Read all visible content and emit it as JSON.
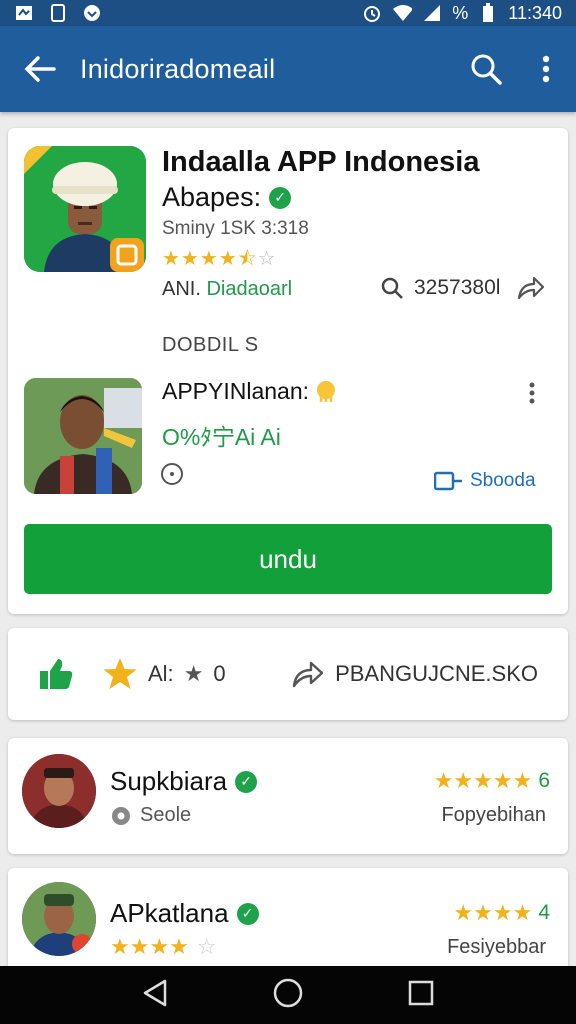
{
  "status": {
    "battery": "%",
    "time": "11:340"
  },
  "appbar": {
    "title": "Inidoriradomeail"
  },
  "app": {
    "name": "Indaalla APP Indonesia",
    "subtitle": "Abapes:",
    "meta": "Sminy 1SK 3:318",
    "rating": 4.5,
    "dev_prefix": "ANI. ",
    "dev_name": "Diadaoarl",
    "downloads": "3257380l",
    "section_label": "DOBDIL S"
  },
  "profile": {
    "name": "APPYINlanan:",
    "tags": "O%ﾀ宁Ai Ai",
    "link": "Sbooda"
  },
  "install_button": "undu",
  "actions": {
    "rating_label": "Al:",
    "rating_value": "0",
    "share_label": "PBANGUJCNE.SKO"
  },
  "reviews": [
    {
      "name": "Supkbiara",
      "sub": "Seole",
      "count": "6",
      "right_text": "Fopyebihan",
      "stars": 5
    },
    {
      "name": "APkatlana",
      "sub": "",
      "count": "4",
      "right_text": "Fesiyebbar",
      "stars": 4.5
    }
  ],
  "colors": {
    "appbar": "#1f5d9d",
    "statusbar": "#1d4f84",
    "install": "#12a03a",
    "star": "#f2b21b",
    "verify": "#1ea34a"
  }
}
